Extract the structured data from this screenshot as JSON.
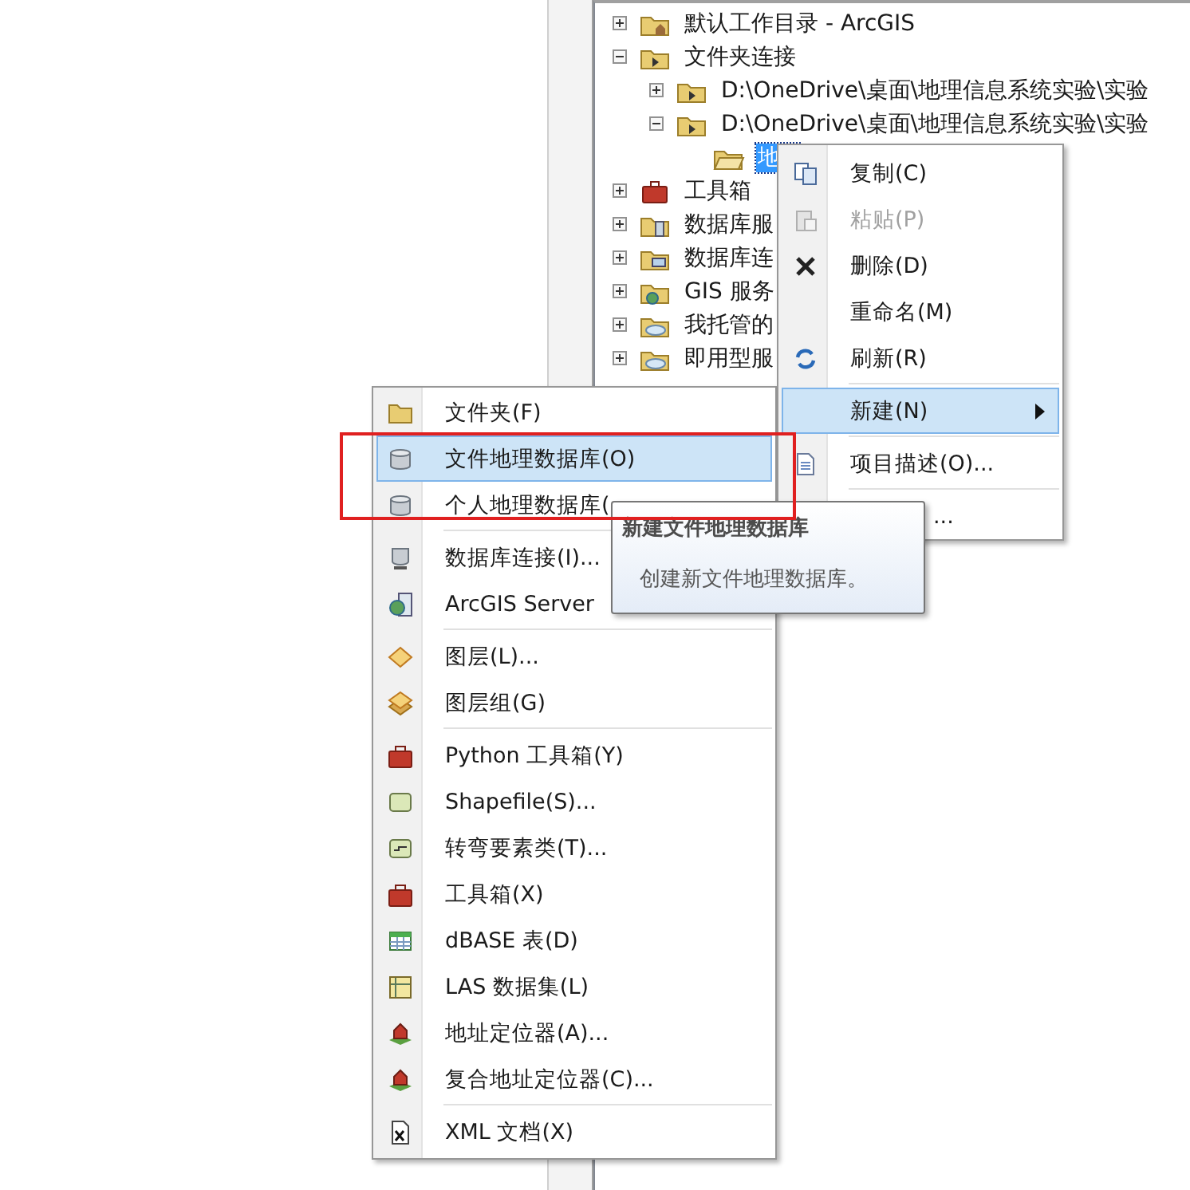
{
  "tree": [
    {
      "label": "默认工作目录 - ArcGIS",
      "kind": "house-folder",
      "expanded": false,
      "selected": false
    },
    {
      "label": "文件夹连接",
      "kind": "folder-arrow",
      "expanded": true,
      "selected": false,
      "children": [
        {
          "label": "D:\\OneDrive\\桌面\\地理信息系统实验\\实验",
          "kind": "folder-arrow",
          "expanded": false,
          "selected": false
        },
        {
          "label": "D:\\OneDrive\\桌面\\地理信息系统实验\\实验",
          "kind": "folder-arrow",
          "expanded": true,
          "selected": false,
          "children": [
            {
              "label": "地",
              "kind": "folder-open",
              "selected": true
            }
          ]
        }
      ]
    },
    {
      "label": "工具箱",
      "kind": "toolbox",
      "expanded": false,
      "selected": false
    },
    {
      "label": "数据库服",
      "kind": "folder-server",
      "expanded": false,
      "selected": false
    },
    {
      "label": "数据库连",
      "kind": "folder-monitor",
      "expanded": false,
      "selected": false
    },
    {
      "label": "GIS 服务",
      "kind": "folder-globe",
      "expanded": false,
      "selected": false
    },
    {
      "label": "我托管的",
      "kind": "folder-cloud",
      "expanded": false,
      "selected": false
    },
    {
      "label": "即用型服",
      "kind": "folder-cloud",
      "expanded": false,
      "selected": false
    }
  ],
  "context_menu": {
    "groups": [
      [
        {
          "label": "复制(C)",
          "kind": "copy",
          "disabled": false,
          "selected": false,
          "submenu": false
        },
        {
          "label": "粘贴(P)",
          "kind": "paste",
          "disabled": true,
          "selected": false,
          "submenu": false
        },
        {
          "label": "删除(D)",
          "kind": "cross",
          "disabled": false,
          "selected": false,
          "submenu": false
        },
        {
          "label": "重命名(M)",
          "kind": "none",
          "disabled": false,
          "selected": false,
          "submenu": false
        },
        {
          "label": "刷新(R)",
          "kind": "refresh",
          "disabled": false,
          "selected": false,
          "submenu": false
        }
      ],
      [
        {
          "label": "新建(N)",
          "kind": "none",
          "disabled": false,
          "selected": true,
          "submenu": true
        }
      ],
      [
        {
          "label": "项目描述(O)...",
          "kind": "document",
          "disabled": false,
          "selected": false,
          "submenu": false
        }
      ],
      [
        {
          "label": "...",
          "kind": "covered",
          "disabled": false,
          "selected": false,
          "submenu": false
        }
      ]
    ]
  },
  "submenu": {
    "groups": [
      [
        {
          "label": "文件夹(F)",
          "kind": "folder",
          "selected": false
        },
        {
          "label": "文件地理数据库(O)",
          "kind": "cylinder",
          "selected": true
        },
        {
          "label": "个人地理数据库(",
          "kind": "cylinder",
          "selected": false
        }
      ],
      [
        {
          "label": "数据库连接(I)...",
          "kind": "cylinder-monitor",
          "selected": false
        },
        {
          "label": "ArcGIS Server",
          "kind": "globe-document",
          "selected": false
        }
      ],
      [
        {
          "label": "图层(L)...",
          "kind": "diamond",
          "selected": false
        },
        {
          "label": "图层组(G)",
          "kind": "diamond-stack",
          "selected": false
        }
      ],
      [
        {
          "label": "Python 工具箱(Y)",
          "kind": "toolbox",
          "selected": false
        },
        {
          "label": "Shapefile(S)...",
          "kind": "square",
          "selected": false
        },
        {
          "label": "转弯要素类(T)...",
          "kind": "square-line",
          "selected": false
        },
        {
          "label": "工具箱(X)",
          "kind": "toolbox",
          "selected": false
        },
        {
          "label": "dBASE 表(D)",
          "kind": "table",
          "selected": false
        },
        {
          "label": "LAS 数据集(L)",
          "kind": "grid-map",
          "selected": false
        },
        {
          "label": "地址定位器(A)...",
          "kind": "house",
          "selected": false
        },
        {
          "label": "复合地址定位器(C)...",
          "kind": "house",
          "selected": false
        }
      ],
      [
        {
          "label": "XML 文档(X)",
          "kind": "x-document",
          "selected": false
        }
      ]
    ]
  },
  "tooltip": {
    "title": "新建文件地理数据库",
    "text": "创建新文件地理数据库。"
  }
}
